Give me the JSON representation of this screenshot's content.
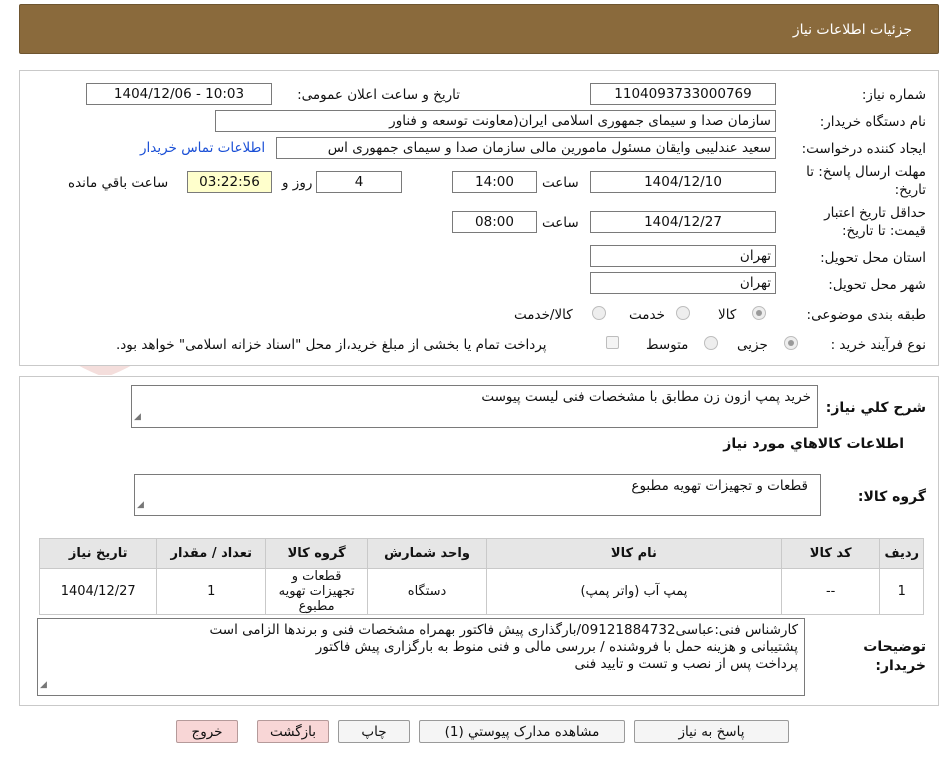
{
  "header": {
    "title": "جزئیات اطلاعات نیاز"
  },
  "fields": {
    "need_number_label": "شماره نیاز:",
    "need_number": "1104093733000769",
    "announce_label": "تاریخ و ساعت اعلان عمومی:",
    "announce_value": "1404/12/06 - 10:03",
    "buyer_org_label": "نام دستگاه خریدار:",
    "buyer_org": "سازمان صدا و سیمای جمهوری اسلامی ایران(معاونت توسعه و فناور",
    "requester_label": "ایجاد کننده درخواست:",
    "requester": "سعید عندلیبی وایقان مسئول مامورین مالی  سازمان صدا و سیمای جمهوری اس",
    "contact_link": "اطلاعات تماس خریدار",
    "deadline_label_1": "مهلت ارسال پاسخ: تا",
    "deadline_label_2": "تاریخ:",
    "deadline_date": "1404/12/10",
    "time_label": "ساعت",
    "deadline_time": "14:00",
    "days_value": "4",
    "days_label": "روز و",
    "remaining_time": "03:22:56",
    "remaining_label": "ساعت باقي مانده",
    "validity_label_1": "حداقل تاریخ اعتبار",
    "validity_label_2": "قیمت: تا تاریخ:",
    "validity_date": "1404/12/27",
    "validity_time_label": "ساعت",
    "validity_time": "08:00",
    "province_label": "استان محل تحویل:",
    "province": "تهران",
    "city_label": "شهر محل تحویل:",
    "city": "تهران",
    "category_label": "طبقه بندی موضوعی:",
    "category_options": [
      "کالا",
      "خدمت",
      "کالا/خدمت"
    ],
    "process_label": "نوع فرآیند خرید :",
    "process_options": [
      "جزیی",
      "متوسط"
    ],
    "payment_note": "پرداخت تمام یا بخشی از مبلغ خرید،از محل \"اسناد خزانه اسلامی\" خواهد بود."
  },
  "summary": {
    "label": "شرح كلي نياز:",
    "value": "خرید پمپ ازون زن مطابق با مشخصات فنی لیست پیوست",
    "goods_info_title": "اطلاعات کالاهاي مورد نياز",
    "group_label": "گروه کالا:",
    "group_value": "قطعات و تجهیزات تهویه مطبوع"
  },
  "table": {
    "headers": [
      "رديف",
      "کد کالا",
      "نام کالا",
      "واحد شمارش",
      "گروه کالا",
      "تعداد / مقدار",
      "تاریخ نیاز"
    ],
    "rows": [
      [
        "1",
        "--",
        "پمپ آب (واتر پمپ)",
        "دستگاه",
        "قطعات و تجهیزات تهویه مطبوع",
        "1",
        "1404/12/27"
      ]
    ]
  },
  "notes": {
    "label_1": "توضیحات",
    "label_2": "خریدار:",
    "line1": "کارشناس فنی:عباسی09121884732/بارگذاری پیش فاکتور بهمراه مشخصات فنی و برندها الزامی است",
    "line2": "پشتیبانی و هزینه حمل با فروشنده / بررسی مالی و فنی منوط به بارگزاری پیش فاکتور",
    "line3": "پرداخت پس از نصب و تست و تایید فنی"
  },
  "buttons": {
    "reply": "پاسخ به نیاز",
    "attachments": "مشاهده مدارک پیوستي (1)",
    "print": "چاپ",
    "back": "بازگشت",
    "exit": "خروج"
  },
  "watermark": "AriaTender.neT",
  "colors": {
    "header": "#8a6a3c",
    "link": "#1a4fd6",
    "remaining_bg": "#ffffcc",
    "exit_bg": "#f8d6d6"
  }
}
